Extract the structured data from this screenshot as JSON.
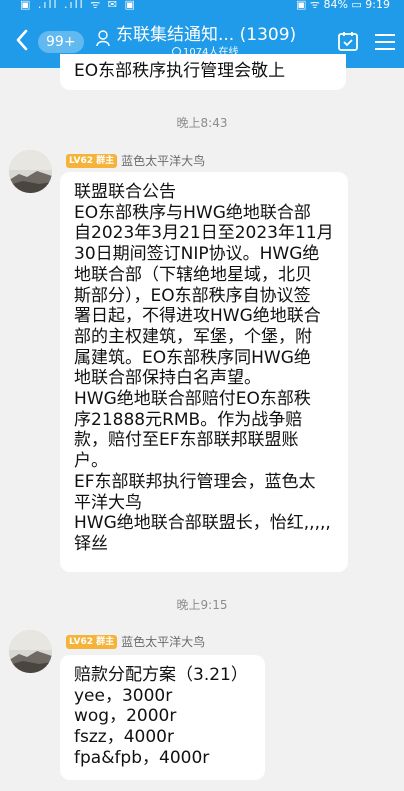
{
  "status_bar": {
    "left": "▣ .ıll .ıll ᯤ ✉ ▣",
    "right": "▣ ᯤ 84% ▭ 9:19"
  },
  "header": {
    "unread_count": "99+",
    "title": "东联集结通知... (1309)",
    "online": "1074人在线",
    "accent_color": "#1f9bea",
    "icons": [
      "back-arrow-icon",
      "group-icon",
      "tasks-icon",
      "menu-icon"
    ]
  },
  "messages": [
    {
      "text": "EO东部秩序执行管理会敬上"
    },
    {
      "time": "晚上8:43",
      "level": "LV62",
      "role": "群主",
      "sender": "蓝色太平洋大鸟",
      "lines": [
        "联盟联合公告",
        "EO东部秩序与HWG绝地联合部",
        "自2023年3月21日至2023年11月",
        "30日期间签订NIP协议。HWG绝",
        "地联合部（下辖绝地星域，北贝",
        "斯部分），EO东部秩序自协议签",
        "署日起，不得进攻HWG绝地联合",
        "部的主权建筑，军堡，个堡，附",
        "属建筑。EO东部秩序同HWG绝",
        "地联合部保持白名声望。",
        "HWG绝地联合部赔付EO东部秩",
        "序21888元RMB。作为战争赔",
        "款，赔付至EF东部联邦联盟账",
        "户。",
        "EF东部联邦执行管理会，蓝色太",
        "平洋大鸟",
        "HWG绝地联合部联盟长，怡红,,,,,",
        "铎丝"
      ]
    },
    {
      "time": "晚上9:15",
      "level": "LV62",
      "role": "群主",
      "sender": "蓝色太平洋大鸟",
      "lines": [
        "赔款分配方案（3.21）",
        "yee，3000r",
        "wog，2000r",
        "fszz，4000r",
        "fpa&fpb，4000r"
      ]
    }
  ]
}
